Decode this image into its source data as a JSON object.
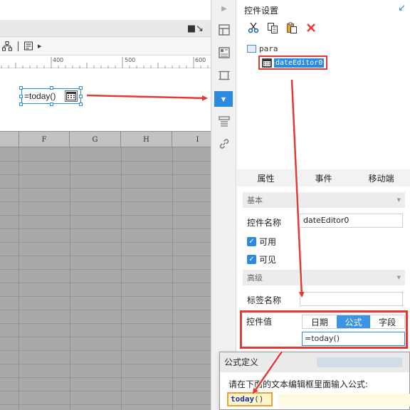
{
  "designer": {
    "ruler_labels": [
      "400",
      "500",
      "600"
    ],
    "date_widget_value": "=today()",
    "column_headers": [
      "F",
      "G",
      "H",
      "I"
    ]
  },
  "strip_icons": [
    "layout-icon",
    "image-grid-icon",
    "frame-icon",
    "date-widget-icon",
    "list-icon",
    "link-icon"
  ],
  "panel": {
    "title": "控件设置",
    "tree": {
      "root_label": "para",
      "selected_label": "dateEditor0"
    },
    "tabs": [
      "属性",
      "事件",
      "移动端"
    ],
    "basic": {
      "header": "基本",
      "name_label": "控件名称",
      "name_value": "dateEditor0",
      "enabled_label": "可用",
      "visible_label": "可见"
    },
    "advanced": {
      "header": "高级",
      "tag_label": "标签名称",
      "tag_value": "",
      "value_label": "控件值",
      "value_options": [
        "日期",
        "公式",
        "字段"
      ],
      "value_selected": "公式",
      "value_input": "=today()"
    }
  },
  "dialog": {
    "title": "公式定义",
    "prompt": "请在下面的文本编辑框里面输入公式:",
    "formula_func": "today",
    "formula_paren": "()"
  },
  "colors": {
    "accent": "#2c8be0",
    "highlight_red": "#e53935",
    "grid_gray": "#a9a9a9"
  }
}
